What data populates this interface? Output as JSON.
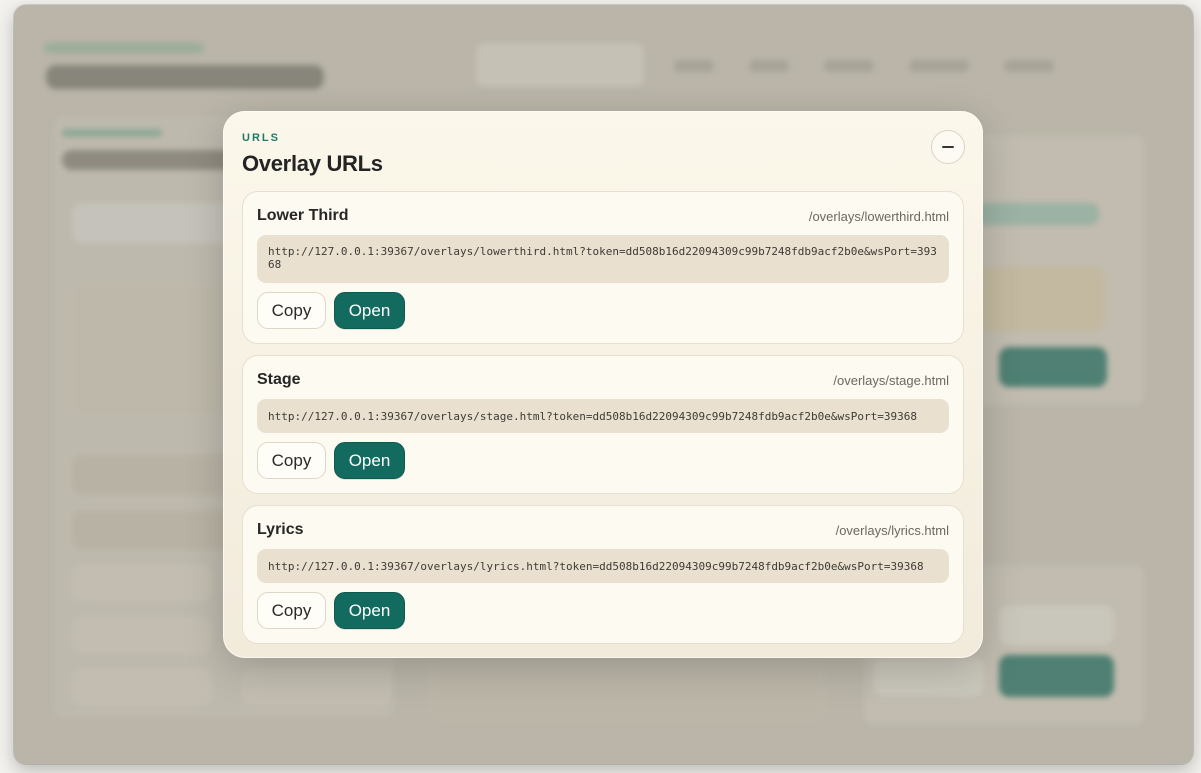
{
  "background": {
    "brand_tagline": "",
    "app_title": "",
    "section_label": "",
    "section_title": ""
  },
  "modal": {
    "eyebrow": "URLS",
    "title": "Overlay URLs",
    "close_icon": "minus-icon",
    "overlays": [
      {
        "name": "Lower Third",
        "path": "/overlays/lowerthird.html",
        "url": "http://127.0.0.1:39367/overlays/lowerthird.html?token=dd508b16d22094309c99b7248fdb9acf2b0e&wsPort=39368",
        "copy_label": "Copy",
        "open_label": "Open"
      },
      {
        "name": "Stage",
        "path": "/overlays/stage.html",
        "url": "http://127.0.0.1:39367/overlays/stage.html?token=dd508b16d22094309c99b7248fdb9acf2b0e&wsPort=39368",
        "copy_label": "Copy",
        "open_label": "Open"
      },
      {
        "name": "Lyrics",
        "path": "/overlays/lyrics.html",
        "url": "http://127.0.0.1:39367/overlays/lyrics.html?token=dd508b16d22094309c99b7248fdb9acf2b0e&wsPort=39368",
        "copy_label": "Copy",
        "open_label": "Open"
      }
    ]
  },
  "colors": {
    "accent": "#136b60",
    "eyebrow": "#1e7a6c",
    "modal_bg": "#fbf7ea",
    "url_bg": "#e9e0cf"
  }
}
